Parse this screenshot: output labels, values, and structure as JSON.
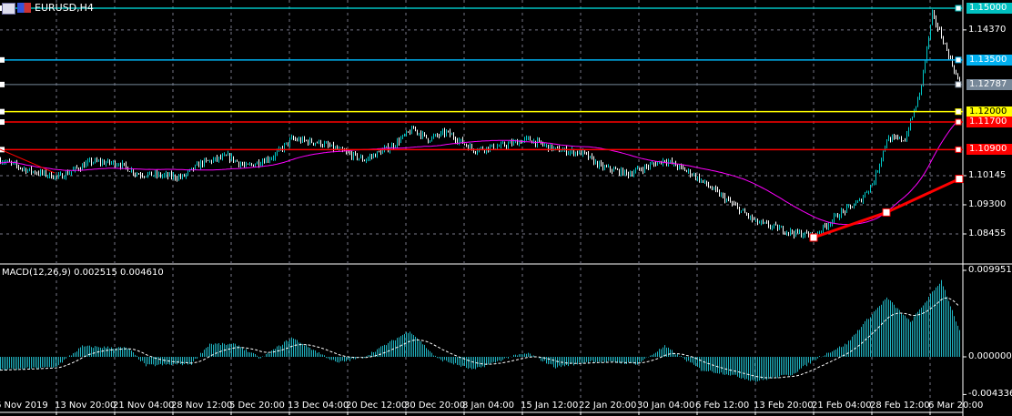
{
  "symbol_title": "EURUSD,H4",
  "macd_label": "MACD(12,26,9) 0.002515 0.004610",
  "colors": {
    "bg": "#000000",
    "bull": "#00c8c8",
    "bear": "#ffffff",
    "ma": "#ff00ff",
    "trend": "#ff0000",
    "hist": "#20b2c0"
  },
  "price_ticks": [
    "1.14370",
    "1.10145",
    "1.09300",
    "1.08455"
  ],
  "price_tick_values": [
    1.1437,
    1.10145,
    1.093,
    1.08455
  ],
  "levels": [
    {
      "label": "1.15000",
      "value": 1.15,
      "color": "#00c0c0"
    },
    {
      "label": "1.13500",
      "value": 1.135,
      "color": "#00b0f0"
    },
    {
      "label": "1.12787",
      "value": 1.12787,
      "color": "#778899"
    },
    {
      "label": "1.12000",
      "value": 1.12,
      "color": "#ffff00"
    },
    {
      "label": "1.11700",
      "value": 1.117,
      "color": "#ff0000"
    },
    {
      "label": "1.10900",
      "value": 1.109,
      "color": "#ff0000"
    }
  ],
  "macd_ticks": [
    "0.009951",
    "0.000000",
    "-0.004336"
  ],
  "macd_tick_values": [
    0.009951,
    0,
    -0.004336
  ],
  "time_labels": [
    "6 Nov 2019",
    "13 Nov 20:00",
    "21 Nov 04:00",
    "28 Nov 12:00",
    "5 Dec 20:00",
    "13 Dec 04:00",
    "20 Dec 12:00",
    "30 Dec 20:00",
    "8 Jan 04:00",
    "15 Jan 12:00",
    "22 Jan 20:00",
    "30 Jan 04:00",
    "6 Feb 12:00",
    "13 Feb 20:00",
    "21 Feb 04:00",
    "28 Feb 12:00",
    "6 Mar 20:00"
  ],
  "chart_data": {
    "type": "line",
    "title": "EURUSD,H4",
    "price_path": [
      [
        0,
        1.106
      ],
      [
        15,
        1.103
      ],
      [
        32,
        1.101
      ],
      [
        50,
        1.1055
      ],
      [
        65,
        1.105
      ],
      [
        75,
        1.102
      ],
      [
        100,
        1.101
      ],
      [
        110,
        1.105
      ],
      [
        125,
        1.107
      ],
      [
        135,
        1.104
      ],
      [
        150,
        1.107
      ],
      [
        160,
        1.112
      ],
      [
        175,
        1.111
      ],
      [
        190,
        1.108
      ],
      [
        200,
        1.106
      ],
      [
        215,
        1.11
      ],
      [
        227,
        1.115
      ],
      [
        235,
        1.112
      ],
      [
        245,
        1.114
      ],
      [
        260,
        1.109
      ],
      [
        275,
        1.11
      ],
      [
        290,
        1.112
      ],
      [
        305,
        1.109
      ],
      [
        320,
        1.108
      ],
      [
        330,
        1.104
      ],
      [
        345,
        1.102
      ],
      [
        355,
        1.104
      ],
      [
        365,
        1.106
      ],
      [
        380,
        1.102
      ],
      [
        400,
        1.094
      ],
      [
        415,
        1.088
      ],
      [
        435,
        1.085
      ],
      [
        447,
        1.084
      ],
      [
        460,
        1.09
      ],
      [
        472,
        1.094
      ],
      [
        480,
        1.1
      ],
      [
        487,
        1.112
      ],
      [
        497,
        1.112
      ],
      [
        505,
        1.125
      ],
      [
        512,
        1.148
      ],
      [
        517,
        1.142
      ],
      [
        527,
        1.128
      ]
    ],
    "trendline": [
      [
        447,
        1.0835
      ],
      [
        487,
        1.0908
      ],
      [
        527,
        1.1005
      ]
    ],
    "macd_hist": [
      [
        0,
        -0.0015
      ],
      [
        30,
        -0.0012
      ],
      [
        45,
        0.0012
      ],
      [
        70,
        0.001
      ],
      [
        80,
        -0.001
      ],
      [
        105,
        -0.0008
      ],
      [
        115,
        0.0015
      ],
      [
        130,
        0.0014
      ],
      [
        143,
        -0.0002
      ],
      [
        160,
        0.0022
      ],
      [
        185,
        -0.0007
      ],
      [
        200,
        0
      ],
      [
        225,
        0.003
      ],
      [
        240,
        -0.0002
      ],
      [
        260,
        -0.0015
      ],
      [
        280,
        0
      ],
      [
        290,
        0.0004
      ],
      [
        305,
        -0.0012
      ],
      [
        325,
        -0.0005
      ],
      [
        350,
        -0.0008
      ],
      [
        365,
        0.0012
      ],
      [
        385,
        -0.0015
      ],
      [
        400,
        -0.002
      ],
      [
        415,
        -0.0028
      ],
      [
        435,
        -0.002
      ],
      [
        450,
        0
      ],
      [
        465,
        0.0015
      ],
      [
        475,
        0.004
      ],
      [
        487,
        0.0068
      ],
      [
        500,
        0.004
      ],
      [
        517,
        0.0088
      ],
      [
        527,
        0.003
      ]
    ],
    "ylim": [
      1.0794,
      1.1524
    ],
    "macd_ylim": [
      -0.0061,
      0.0108
    ]
  }
}
